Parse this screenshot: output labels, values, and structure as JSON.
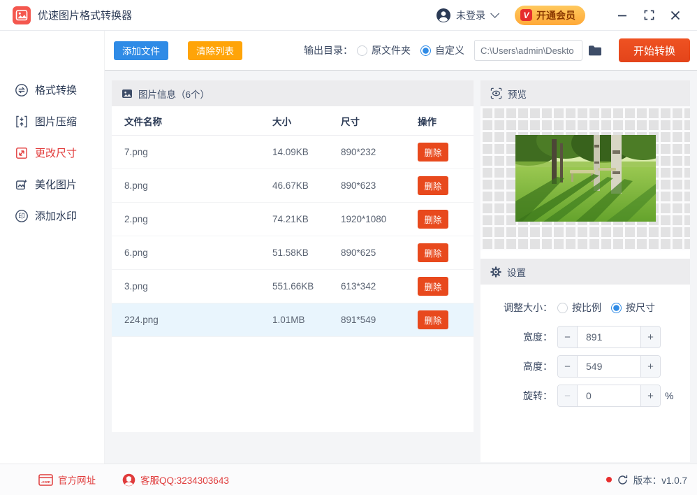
{
  "titlebar": {
    "app_title": "优速图片格式转换器",
    "login_status": "未登录",
    "vip_button": "开通会员",
    "vip_badge": "V"
  },
  "toolbar": {
    "add_files": "添加文件",
    "clear_list": "清除列表",
    "output_dir_label": "输出目录：",
    "radio_original_folder": "原文件夹",
    "radio_custom": "自定义",
    "output_path": "C:\\Users\\admin\\Deskto",
    "start_convert": "开始转换"
  },
  "sidebar": {
    "items": [
      {
        "label": "格式转换",
        "active": false
      },
      {
        "label": "图片压缩",
        "active": false
      },
      {
        "label": "更改尺寸",
        "active": true
      },
      {
        "label": "美化图片",
        "active": false
      },
      {
        "label": "添加水印",
        "active": false
      }
    ]
  },
  "file_panel": {
    "header": "图片信息（6个）",
    "columns": {
      "name": "文件名称",
      "size": "大小",
      "dims": "尺寸",
      "ops": "操作"
    },
    "delete_label": "删除",
    "rows": [
      {
        "name": "7.png",
        "size": "14.09KB",
        "dims": "890*232",
        "selected": false
      },
      {
        "name": "8.png",
        "size": "46.67KB",
        "dims": "890*623",
        "selected": false
      },
      {
        "name": "2.png",
        "size": "74.21KB",
        "dims": "1920*1080",
        "selected": false
      },
      {
        "name": "6.png",
        "size": "51.58KB",
        "dims": "890*625",
        "selected": false
      },
      {
        "name": "3.png",
        "size": "551.66KB",
        "dims": "613*342",
        "selected": false
      },
      {
        "name": "224.png",
        "size": "1.01MB",
        "dims": "891*549",
        "selected": true
      }
    ]
  },
  "preview_panel": {
    "header": "预览"
  },
  "settings_panel": {
    "header": "设置",
    "resize_label": "调整大小：",
    "radio_ratio": "按比例",
    "radio_dimensions": "按尺寸",
    "width_label": "宽度：",
    "width_value": "891",
    "height_label": "高度：",
    "height_value": "549",
    "rotate_label": "旋转：",
    "rotate_value": "0",
    "rotate_unit": "%"
  },
  "statusbar": {
    "official_site": "官方网址",
    "qq_service": "客服QQ:3234303643",
    "version": "版本：v1.0.7"
  },
  "colors": {
    "accent_blue": "#2f8be6",
    "accent_orange": "#ffa408",
    "accent_red_orange": "#e8491d",
    "active_red": "#e23c3c",
    "vip_gold": "#ffb84d",
    "selected_row": "#e9f5fd",
    "text_navy": "#2b3a55"
  }
}
